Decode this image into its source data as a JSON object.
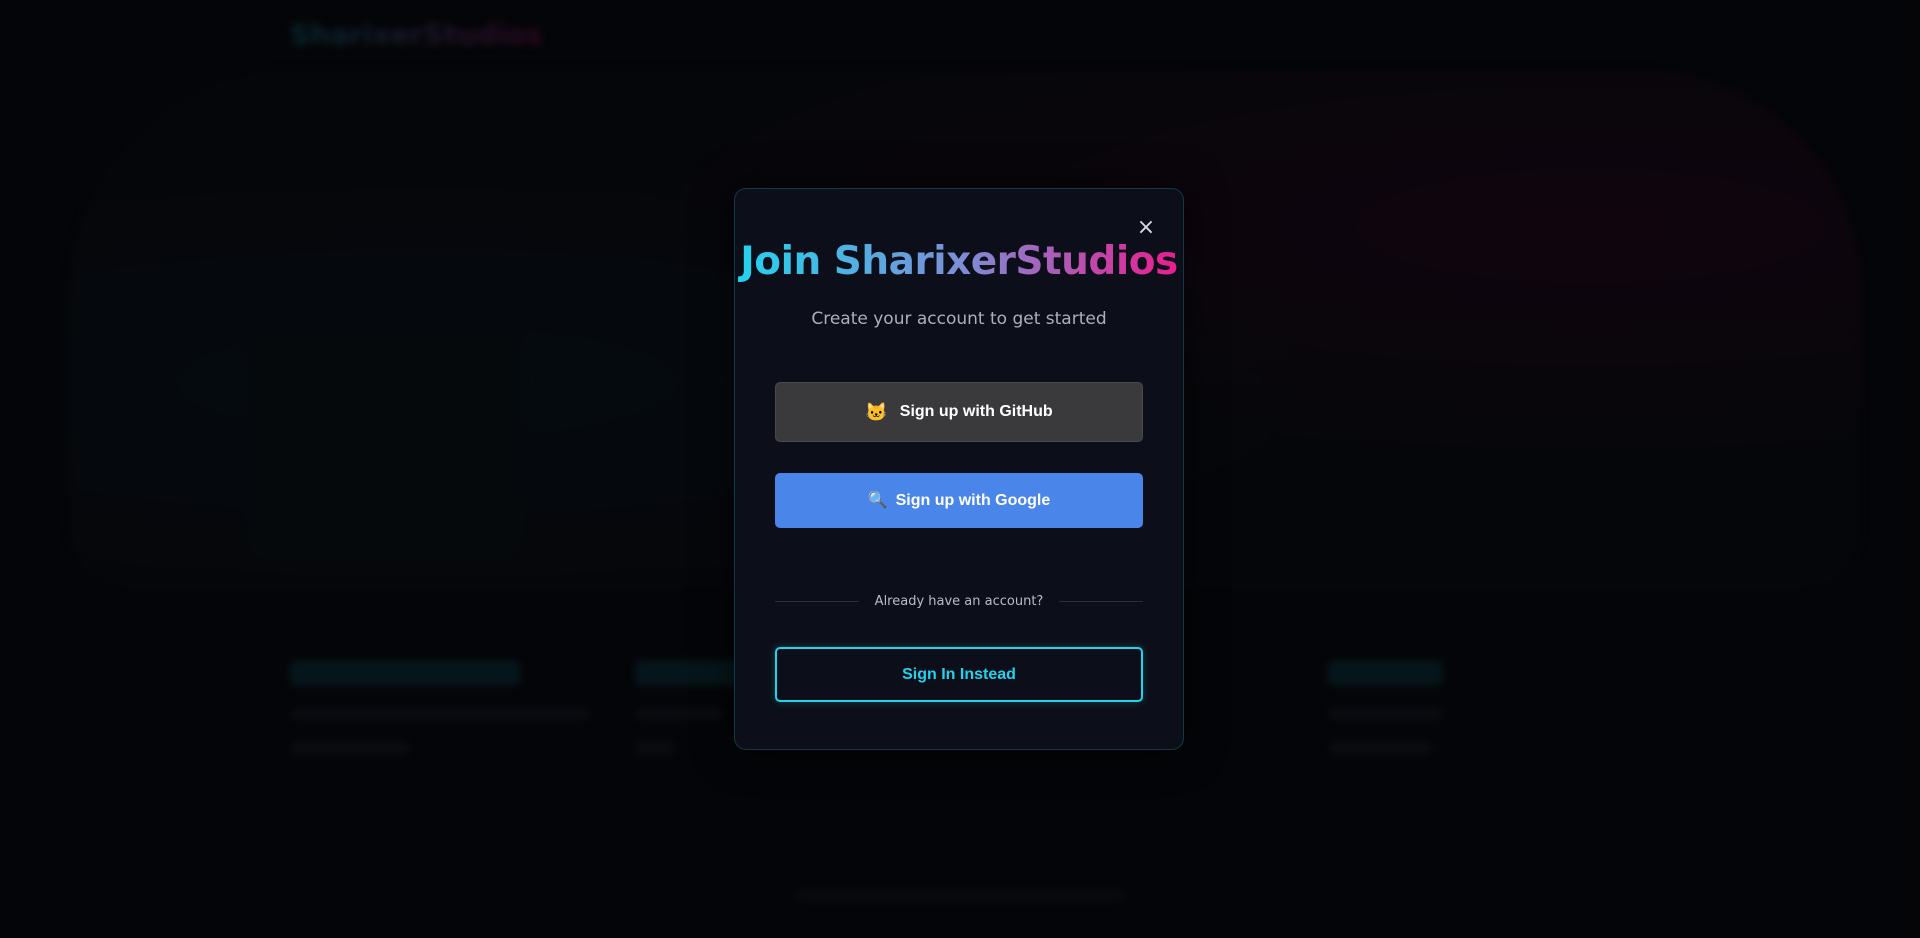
{
  "background": {
    "brand": "SharixerStudios"
  },
  "modal": {
    "close_icon": "×",
    "title": "Join SharixerStudios",
    "subtitle": "Create your account to get started",
    "github_button": {
      "icon": "🐱",
      "label": "Sign up with GitHub"
    },
    "google_button": {
      "icon": "🔍",
      "label": "Sign up with Google"
    },
    "divider_text": "Already have an account?",
    "signin_button": {
      "label": "Sign In Instead"
    }
  },
  "colors": {
    "accent_cyan": "#22d3ee",
    "accent_pink": "#ec1a8c",
    "google_blue": "#4a86ea",
    "github_gray": "#3a3a3c"
  }
}
